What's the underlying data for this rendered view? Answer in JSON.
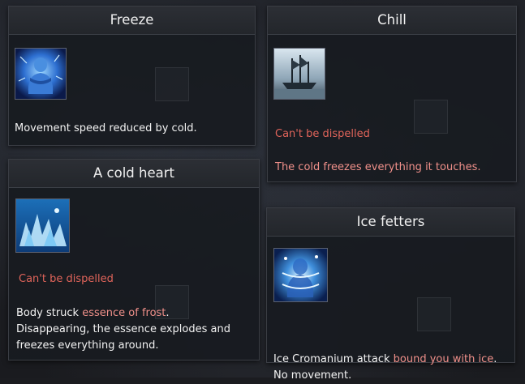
{
  "panels": {
    "freeze": {
      "title": "Freeze",
      "icon": "frozen-figure-icon",
      "description": "Movement speed reduced by cold."
    },
    "chill": {
      "title": "Chill",
      "icon": "frozen-ship-icon",
      "status": "Can't be dispelled",
      "description": "The cold freezes everything it touches."
    },
    "cold_heart": {
      "title": "A cold heart",
      "icon": "ice-crystals-icon",
      "status": "Can't be dispelled",
      "line1_prefix": "Body struck ",
      "line1_highlight": "essence of frost",
      "line1_suffix": ".",
      "line2": " Disappearing, the essence explodes and",
      "line3": "freezes everything around."
    },
    "ice_fetters": {
      "title": "Ice fetters",
      "icon": "ice-chains-figure-icon",
      "line1_prefix": "Ice Cromanium attack ",
      "line1_highlight": "bound you with ice",
      "line1_suffix": ".",
      "line2": "No movement."
    }
  },
  "colors": {
    "status_red": "#e0645a",
    "highlight_pink": "#f0908a",
    "panel_bg": "#181b20",
    "header_bg": "#2c2f35"
  }
}
